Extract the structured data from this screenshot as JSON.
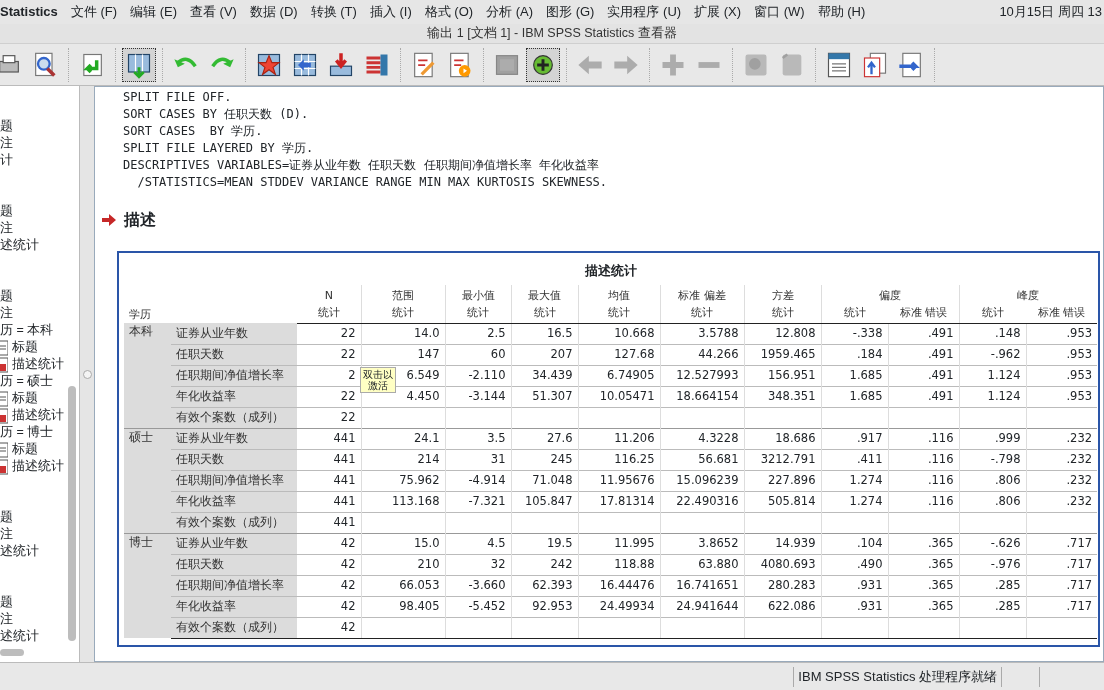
{
  "menubar": {
    "app": "Statistics",
    "items": [
      "文件 (F)",
      "编辑 (E)",
      "查看 (V)",
      "数据 (D)",
      "转换 (T)",
      "插入 (I)",
      "格式 (O)",
      "分析 (A)",
      "图形 (G)",
      "实用程序 (U)",
      "扩展 (X)",
      "窗口 (W)",
      "帮助 (H)"
    ],
    "clock": "10月15日 周四  13"
  },
  "window": {
    "title": "输出 1 [文档 1] - IBM SPSS Statistics 查看器"
  },
  "toolbar_groups": [
    [
      {
        "disabled": false,
        "pressed": false
      },
      {
        "disabled": false,
        "pressed": false
      }
    ],
    [
      {
        "disabled": false,
        "pressed": false
      }
    ],
    [
      {
        "disabled": false,
        "pressed": true
      }
    ],
    [
      {
        "disabled": false,
        "pressed": false
      },
      {
        "disabled": false,
        "pressed": false
      }
    ],
    [
      {
        "disabled": false,
        "pressed": false
      },
      {
        "disabled": false,
        "pressed": false
      },
      {
        "disabled": false,
        "pressed": false
      },
      {
        "disabled": false,
        "pressed": false
      }
    ],
    [
      {
        "disabled": false,
        "pressed": false
      },
      {
        "disabled": false,
        "pressed": false
      }
    ],
    [
      {
        "disabled": true,
        "pressed": false
      },
      {
        "disabled": false,
        "pressed": true
      }
    ],
    [
      {
        "disabled": true,
        "pressed": false
      },
      {
        "disabled": true,
        "pressed": false
      }
    ],
    [
      {
        "disabled": true,
        "pressed": false
      },
      {
        "disabled": true,
        "pressed": false
      }
    ],
    [
      {
        "disabled": true,
        "pressed": false
      },
      {
        "disabled": true,
        "pressed": false
      }
    ],
    [
      {
        "disabled": false,
        "pressed": false
      },
      {
        "disabled": false,
        "pressed": false
      },
      {
        "disabled": false,
        "pressed": false
      }
    ]
  ],
  "outline": [
    {
      "items": [
        {
          "label": "题"
        },
        {
          "label": "注"
        },
        {
          "label": "计"
        }
      ]
    },
    {
      "items": [
        {
          "label": "题"
        },
        {
          "label": "注"
        },
        {
          "label": "述统计"
        }
      ]
    },
    {
      "items": [
        {
          "label": "题"
        },
        {
          "label": "注"
        },
        {
          "label": "历 = 本科",
          "children": [
            {
              "label": "标题",
              "kind": "title"
            },
            {
              "label": "描述统计",
              "kind": "table"
            }
          ]
        },
        {
          "label": "历 = 硕士",
          "children": [
            {
              "label": "标题",
              "kind": "title"
            },
            {
              "label": "描述统计",
              "kind": "table"
            }
          ]
        },
        {
          "label": "历 = 博士",
          "children": [
            {
              "label": "标题",
              "kind": "title"
            },
            {
              "label": "描述统计",
              "kind": "table"
            }
          ]
        }
      ]
    },
    {
      "items": [
        {
          "label": "题"
        },
        {
          "label": "注"
        },
        {
          "label": "述统计"
        }
      ]
    },
    {
      "items": [
        {
          "label": "题"
        },
        {
          "label": "注"
        },
        {
          "label": "述统计"
        }
      ]
    }
  ],
  "syntax": [
    "SPLIT FILE OFF.",
    "SORT CASES BY 任职天数 (D).",
    "SORT CASES  BY 学历.",
    "SPLIT FILE LAYERED BY 学历.",
    "DESCRIPTIVES VARIABLES=证券从业年数 任职天数 任职期间净值增长率 年化收益率",
    "  /STATISTICS=MEAN STDDEV VARIANCE RANGE MIN MAX KURTOSIS SKEWNESS."
  ],
  "heading": "描述",
  "table": {
    "title": "描述统计",
    "corner_label": "学历",
    "columns": [
      {
        "label": "N",
        "sublabels": [
          "统计"
        ]
      },
      {
        "label": "范围",
        "sublabels": [
          "统计"
        ]
      },
      {
        "label": "最小值",
        "sublabels": [
          "统计"
        ]
      },
      {
        "label": "最大值",
        "sublabels": [
          "统计"
        ]
      },
      {
        "label": "均值",
        "sublabels": [
          "统计"
        ]
      },
      {
        "label": "标准 偏差",
        "sublabels": [
          "统计"
        ]
      },
      {
        "label": "方差",
        "sublabels": [
          "统计"
        ]
      },
      {
        "label": "偏度",
        "sublabels": [
          "统计",
          "标准 错误"
        ]
      },
      {
        "label": "峰度",
        "sublabels": [
          "统计",
          "标准 错误"
        ]
      }
    ],
    "groups": [
      {
        "label": "本科",
        "rows": [
          {
            "label": "证券从业年数",
            "cells": [
              "22",
              "14.0",
              "2.5",
              "16.5",
              "10.668",
              "3.5788",
              "12.808",
              "-.338",
              ".491",
              ".148",
              ".953"
            ]
          },
          {
            "label": "任职天数",
            "cells": [
              "22",
              "147",
              "60",
              "207",
              "127.68",
              "44.266",
              "1959.465",
              ".184",
              ".491",
              "-.962",
              ".953"
            ]
          },
          {
            "label": "任职期间净值增长率",
            "cells": [
              "2",
              "6.549",
              "-2.110",
              "34.439",
              "6.74905",
              "12.527993",
              "156.951",
              "1.685",
              ".491",
              "1.124",
              ".953"
            ]
          },
          {
            "label": "年化收益率",
            "cells": [
              "22",
              "4.450",
              "-3.144",
              "51.307",
              "10.05471",
              "18.664154",
              "348.351",
              "1.685",
              ".491",
              "1.124",
              ".953"
            ]
          },
          {
            "label": "有效个案数（成列）",
            "cells": [
              "22"
            ]
          }
        ]
      },
      {
        "label": "硕士",
        "rows": [
          {
            "label": "证券从业年数",
            "cells": [
              "441",
              "24.1",
              "3.5",
              "27.6",
              "11.206",
              "4.3228",
              "18.686",
              ".917",
              ".116",
              ".999",
              ".232"
            ]
          },
          {
            "label": "任职天数",
            "cells": [
              "441",
              "214",
              "31",
              "245",
              "116.25",
              "56.681",
              "3212.791",
              ".411",
              ".116",
              "-.798",
              ".232"
            ]
          },
          {
            "label": "任职期间净值增长率",
            "cells": [
              "441",
              "75.962",
              "-4.914",
              "71.048",
              "11.95676",
              "15.096239",
              "227.896",
              "1.274",
              ".116",
              ".806",
              ".232"
            ]
          },
          {
            "label": "年化收益率",
            "cells": [
              "441",
              "113.168",
              "-7.321",
              "105.847",
              "17.81314",
              "22.490316",
              "505.814",
              "1.274",
              ".116",
              ".806",
              ".232"
            ]
          },
          {
            "label": "有效个案数（成列）",
            "cells": [
              "441"
            ]
          }
        ]
      },
      {
        "label": "博士",
        "rows": [
          {
            "label": "证券从业年数",
            "cells": [
              "42",
              "15.0",
              "4.5",
              "19.5",
              "11.995",
              "3.8652",
              "14.939",
              ".104",
              ".365",
              "-.626",
              ".717"
            ]
          },
          {
            "label": "任职天数",
            "cells": [
              "42",
              "210",
              "32",
              "242",
              "118.88",
              "63.880",
              "4080.693",
              ".490",
              ".365",
              "-.976",
              ".717"
            ]
          },
          {
            "label": "任职期间净值增长率",
            "cells": [
              "42",
              "66.053",
              "-3.660",
              "62.393",
              "16.44476",
              "16.741651",
              "280.283",
              ".931",
              ".365",
              ".285",
              ".717"
            ]
          },
          {
            "label": "年化收益率",
            "cells": [
              "42",
              "98.405",
              "-5.452",
              "92.953",
              "24.49934",
              "24.941644",
              "622.086",
              ".931",
              ".365",
              ".285",
              ".717"
            ]
          },
          {
            "label": "有效个案数（成列）",
            "cells": [
              "42"
            ]
          }
        ]
      }
    ]
  },
  "tooltip": {
    "lines": [
      "双击以",
      "激活"
    ]
  },
  "status_bar": {
    "text": "IBM SPSS Statistics 处理程序就绪"
  }
}
